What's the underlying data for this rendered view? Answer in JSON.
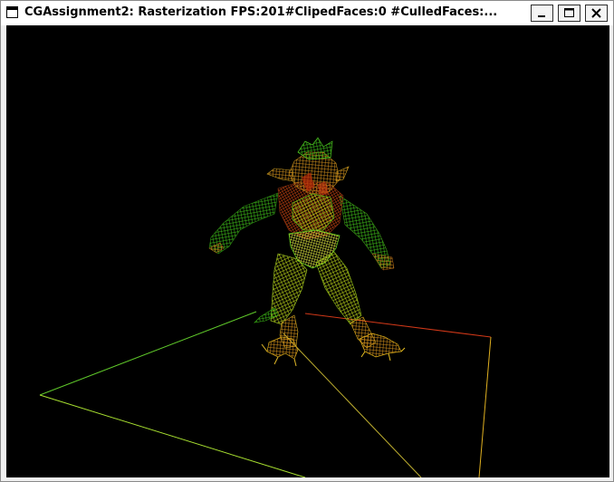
{
  "window": {
    "title": "CGAssignment2: Rasterization FPS:201#ClipedFaces:0     #CulledFaces:...",
    "icon": "window-icon"
  },
  "controls": {
    "minimize_icon": "minimize-icon",
    "maximize_icon": "maximize-icon",
    "close_icon": "close-icon"
  },
  "scene": {
    "background": "#000000",
    "model": "wireframe-demon-figure",
    "wire_colors": [
      "#2fa814",
      "#8fcf10",
      "#d8c020",
      "#c85a10",
      "#e8e030",
      "#5ad21a"
    ],
    "ground_colors": {
      "left_edge": "#7ee02a",
      "back_edge": "#d83a1a",
      "right_edge": "#e0d020",
      "diagonal": "#a0b040"
    }
  }
}
